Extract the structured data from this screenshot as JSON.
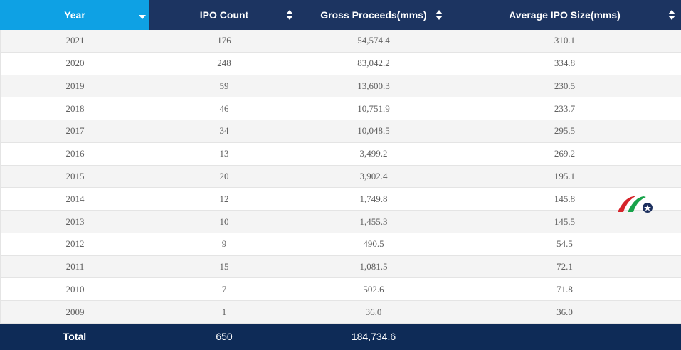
{
  "colors": {
    "header_bg": "#1c3461",
    "header_active_bg": "#0ea1e4",
    "total_bg": "#0e2b57",
    "row_stripe": "#f4f4f4",
    "logo_red": "#d6232a",
    "logo_green": "#17a34a",
    "logo_navy": "#1c2f5e"
  },
  "header": {
    "year": "Year",
    "ipo_count": "IPO Count",
    "gross_proceeds": "Gross Proceeds(mms)",
    "avg_size": "Average IPO Size(mms)",
    "active_sort_icon": "sort-desc-icon",
    "sort_icon": "sort-both-icon"
  },
  "rows": [
    {
      "year": "2021",
      "count": "176",
      "proceeds": "54,574.4",
      "avg": "310.1"
    },
    {
      "year": "2020",
      "count": "248",
      "proceeds": "83,042.2",
      "avg": "334.8"
    },
    {
      "year": "2019",
      "count": "59",
      "proceeds": "13,600.3",
      "avg": "230.5"
    },
    {
      "year": "2018",
      "count": "46",
      "proceeds": "10,751.9",
      "avg": "233.7"
    },
    {
      "year": "2017",
      "count": "34",
      "proceeds": "10,048.5",
      "avg": "295.5"
    },
    {
      "year": "2016",
      "count": "13",
      "proceeds": "3,499.2",
      "avg": "269.2"
    },
    {
      "year": "2015",
      "count": "20",
      "proceeds": "3,902.4",
      "avg": "195.1"
    },
    {
      "year": "2014",
      "count": "12",
      "proceeds": "1,749.8",
      "avg": "145.8"
    },
    {
      "year": "2013",
      "count": "10",
      "proceeds": "1,455.3",
      "avg": "145.5"
    },
    {
      "year": "2012",
      "count": "9",
      "proceeds": "490.5",
      "avg": "54.5"
    },
    {
      "year": "2011",
      "count": "15",
      "proceeds": "1,081.5",
      "avg": "72.1"
    },
    {
      "year": "2010",
      "count": "7",
      "proceeds": "502.6",
      "avg": "71.8"
    },
    {
      "year": "2009",
      "count": "1",
      "proceeds": "36.0",
      "avg": "36.0"
    }
  ],
  "total": {
    "label": "Total",
    "count": "650",
    "proceeds": "184,734.6",
    "avg": ""
  },
  "logo_icon": "site-logo-icon"
}
